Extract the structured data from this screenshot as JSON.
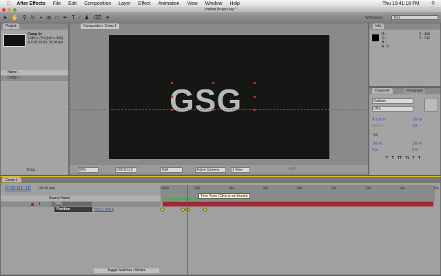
{
  "menubar": {
    "app": "After Effects",
    "items": [
      "File",
      "Edit",
      "Composition",
      "Layer",
      "Effect",
      "Animation",
      "View",
      "Window",
      "Help"
    ],
    "clock": "Thu 10:41:18 PM"
  },
  "window": {
    "title": "Untitled Project.aep *"
  },
  "workspace": {
    "label": "Workspace:",
    "value": "Text"
  },
  "project": {
    "tab": "Project",
    "comp_name": "Comp 1▾",
    "comp_size": "1280 x 720  (640 x 360)",
    "comp_duration": "Δ 0:00:16:00, 30.00 fps",
    "column_name": "Name",
    "items": [
      "Comp 1"
    ],
    "bpc": "8 bpc"
  },
  "composition": {
    "tab": "Composition: Comp 1",
    "text": "GSG",
    "zoom": "50%",
    "timecode": "0:00:01:13",
    "resolution": "Half",
    "camera": "Active Camera",
    "views": "1 View",
    "exposure": "+0.0"
  },
  "info": {
    "tab": "Info",
    "labels": [
      "R :",
      "G :",
      "B :",
      "A :"
    ],
    "a_value": "0",
    "x": "X : 446",
    "y": "Y : 742"
  },
  "character": {
    "tabs": [
      "Character",
      "Paragraph"
    ],
    "font": "Gotham",
    "style": "Ultra",
    "size": "229 px",
    "leading": "169 px",
    "kerning": "Metrics",
    "tracking": "-13",
    "stroke": "- px",
    "vscale": "100 %",
    "hscale": "100 %",
    "baseline": "0 px",
    "tsume": "0 %",
    "styles": [
      "T",
      "T",
      "TT",
      "Tt",
      "T",
      "T"
    ]
  },
  "timeline": {
    "tab": "Comp 1",
    "timecode": "0:00:01:15",
    "fps": "(30.00 fps)",
    "col_source": "Source Name",
    "layers": [
      {
        "num": "1",
        "name": "GSG",
        "color": "#c02020"
      }
    ],
    "property": {
      "name": "Position",
      "value": "603.6, 428.4"
    },
    "ticks": [
      "0:00s",
      "02s",
      "04s",
      "06s",
      "08s",
      "10s",
      "12s",
      "14s",
      "16s"
    ],
    "tooltip": "Time Ruler (Click to set thumb)",
    "toggle": "Toggle Switches / Modes",
    "current_time_s": 1.5,
    "keyframes_s": [
      0,
      1.2,
      1.5,
      2.5
    ]
  },
  "colors": {
    "accent": "#e0c030",
    "playhead": "#e02020",
    "layer_bar": "#9a2a34",
    "work_area": "#40b040"
  }
}
